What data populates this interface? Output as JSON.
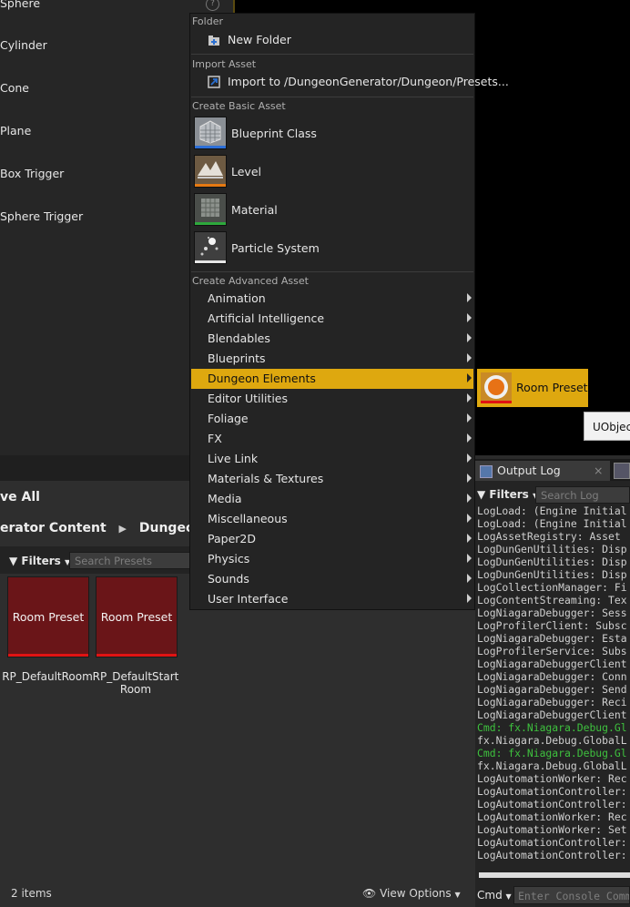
{
  "place_actors": {
    "items": [
      "Sphere",
      "Cylinder",
      "Cone",
      "Plane",
      "Box Trigger",
      "Sphere Trigger"
    ],
    "help_glyph": "?"
  },
  "context_menu": {
    "folder": {
      "header": "Folder",
      "new_folder": "New Folder"
    },
    "import": {
      "header": "Import Asset",
      "import_to": "Import to /DungeonGenerator/Dungeon/Presets..."
    },
    "basic": {
      "header": "Create Basic Asset",
      "items": [
        {
          "label": "Blueprint Class",
          "icon": "blueprint-class-icon",
          "accent": "#2c6fd8"
        },
        {
          "label": "Level",
          "icon": "level-icon",
          "accent": "#e67a12"
        },
        {
          "label": "Material",
          "icon": "material-icon",
          "accent": "#2da83c"
        },
        {
          "label": "Particle System",
          "icon": "particle-system-icon",
          "accent": "#e6e6e6"
        }
      ]
    },
    "advanced": {
      "header": "Create Advanced Asset",
      "items": [
        "Animation",
        "Artificial Intelligence",
        "Blendables",
        "Blueprints",
        "Dungeon Elements",
        "Editor Utilities",
        "Foliage",
        "FX",
        "Live Link",
        "Materials & Textures",
        "Media",
        "Miscellaneous",
        "Paper2D",
        "Physics",
        "Sounds",
        "User Interface"
      ],
      "active_item": "Dungeon Elements"
    }
  },
  "submenu": {
    "label": "Room Preset",
    "icon": "room-preset-icon"
  },
  "tooltip": {
    "text": "UObject"
  },
  "content_browser": {
    "save_all": "ve All",
    "path": [
      "erator Content",
      "Dungeon"
    ],
    "filters_label": "Filters",
    "search_placeholder": "Search Presets",
    "assets": [
      {
        "type_label": "Room Preset",
        "name": "RP_DefaultRoom"
      },
      {
        "type_label": "Room Preset",
        "name": "RP_DefaultStart Room"
      }
    ],
    "items_count": "2 items",
    "view_options": "View Options"
  },
  "output_log": {
    "tab_label": "Output Log",
    "filters_label": "Filters",
    "search_placeholder": "Search Log",
    "lines": [
      {
        "text": "LogLoad: (Engine Initial",
        "cmd": false
      },
      {
        "text": "LogLoad: (Engine Initial",
        "cmd": false
      },
      {
        "text": "LogAssetRegistry: Asset",
        "cmd": false
      },
      {
        "text": "LogDunGenUtilities: Disp",
        "cmd": false
      },
      {
        "text": "LogDunGenUtilities: Disp",
        "cmd": false
      },
      {
        "text": "LogDunGenUtilities: Disp",
        "cmd": false
      },
      {
        "text": "LogCollectionManager: Fi",
        "cmd": false
      },
      {
        "text": "LogContentStreaming: Tex",
        "cmd": false
      },
      {
        "text": "LogNiagaraDebugger: Sess",
        "cmd": false
      },
      {
        "text": "LogProfilerClient: Subsc",
        "cmd": false
      },
      {
        "text": "LogNiagaraDebugger: Esta",
        "cmd": false
      },
      {
        "text": "LogProfilerService: Subs",
        "cmd": false
      },
      {
        "text": "LogNiagaraDebuggerClient",
        "cmd": false
      },
      {
        "text": "LogNiagaraDebugger: Conn",
        "cmd": false
      },
      {
        "text": "LogNiagaraDebugger: Send",
        "cmd": false
      },
      {
        "text": "LogNiagaraDebugger: Reci",
        "cmd": false
      },
      {
        "text": "LogNiagaraDebuggerClient",
        "cmd": false
      },
      {
        "text": "Cmd: fx.Niagara.Debug.Gl",
        "cmd": true
      },
      {
        "text": "fx.Niagara.Debug.GlobalL",
        "cmd": false
      },
      {
        "text": "Cmd: fx.Niagara.Debug.Gl",
        "cmd": true
      },
      {
        "text": "fx.Niagara.Debug.GlobalL",
        "cmd": false
      },
      {
        "text": "LogAutomationWorker: Rec",
        "cmd": false
      },
      {
        "text": "LogAutomationController:",
        "cmd": false
      },
      {
        "text": "LogAutomationController:",
        "cmd": false
      },
      {
        "text": "LogAutomationWorker: Rec",
        "cmd": false
      },
      {
        "text": "LogAutomationWorker: Set",
        "cmd": false
      },
      {
        "text": "LogAutomationController:",
        "cmd": false
      },
      {
        "text": "LogAutomationController:",
        "cmd": false
      }
    ],
    "cmd_label": "Cmd",
    "console_placeholder": "Enter Console Comm",
    "cmd_color": "#3ec13e"
  }
}
